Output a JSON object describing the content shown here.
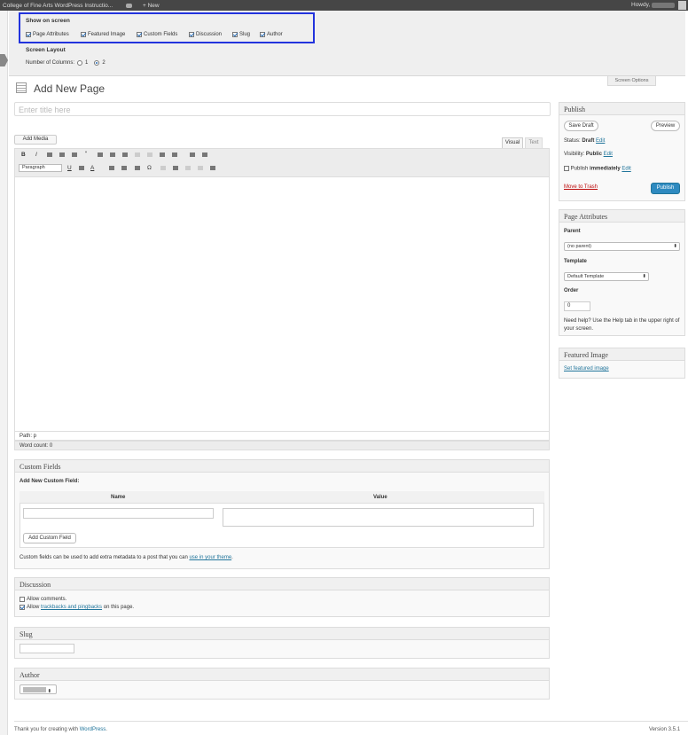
{
  "adminbar": {
    "site_title": "College of Fine Arts WordPress Instructio...",
    "new_label": "+ New",
    "howdy": "Howdy,"
  },
  "screen_options": {
    "show_on_screen": "Show on screen",
    "checkboxes": [
      {
        "label": "Page Attributes",
        "checked": true
      },
      {
        "label": "Featured Image",
        "checked": true
      },
      {
        "label": "Custom Fields",
        "checked": true
      },
      {
        "label": "Discussion",
        "checked": true
      },
      {
        "label": "Slug",
        "checked": true
      },
      {
        "label": "Author",
        "checked": true
      }
    ],
    "layout_title": "Screen Layout",
    "columns_label": "Number of Columns:",
    "col1": "1",
    "col2": "2",
    "tab_label": "Screen Options"
  },
  "page": {
    "title": "Add New Page",
    "title_placeholder": "Enter title here"
  },
  "editor": {
    "add_media": "Add Media",
    "tab_visual": "Visual",
    "tab_text": "Text",
    "format": "Paragraph",
    "path": "Path: p",
    "word_count": "Word count: 0"
  },
  "custom_fields": {
    "title": "Custom Fields",
    "add_new": "Add New Custom Field:",
    "col_name": "Name",
    "col_value": "Value",
    "add_button": "Add Custom Field",
    "help": "Custom fields can be used to add extra metadata to a post that you can",
    "help_link": "use in your theme",
    "help_end": "."
  },
  "discussion": {
    "title": "Discussion",
    "allow_comments": "Allow comments.",
    "allow_trackbacks_pre": "Allow",
    "allow_trackbacks_link": "trackbacks and pingbacks",
    "allow_trackbacks_post": "on this page."
  },
  "slug": {
    "title": "Slug"
  },
  "author": {
    "title": "Author"
  },
  "publish": {
    "title": "Publish",
    "save_draft": "Save Draft",
    "preview": "Preview",
    "status_label": "Status:",
    "status_value": "Draft",
    "visibility_label": "Visibility:",
    "visibility_value": "Public",
    "publish_label": "Publish",
    "publish_value": "immediately",
    "edit": "Edit",
    "trash": "Move to Trash",
    "publish_button": "Publish"
  },
  "page_attributes": {
    "title": "Page Attributes",
    "parent_label": "Parent",
    "parent_value": "(no parent)",
    "template_label": "Template",
    "template_value": "Default Template",
    "order_label": "Order",
    "order_value": "0",
    "help": "Need help? Use the Help tab in the upper right of your screen."
  },
  "featured_image": {
    "title": "Featured Image",
    "set_link": "Set featured image"
  },
  "footer": {
    "thanks": "Thank you for creating with",
    "wp": "WordPress",
    "dot": ".",
    "version": "Version 3.5.1"
  }
}
